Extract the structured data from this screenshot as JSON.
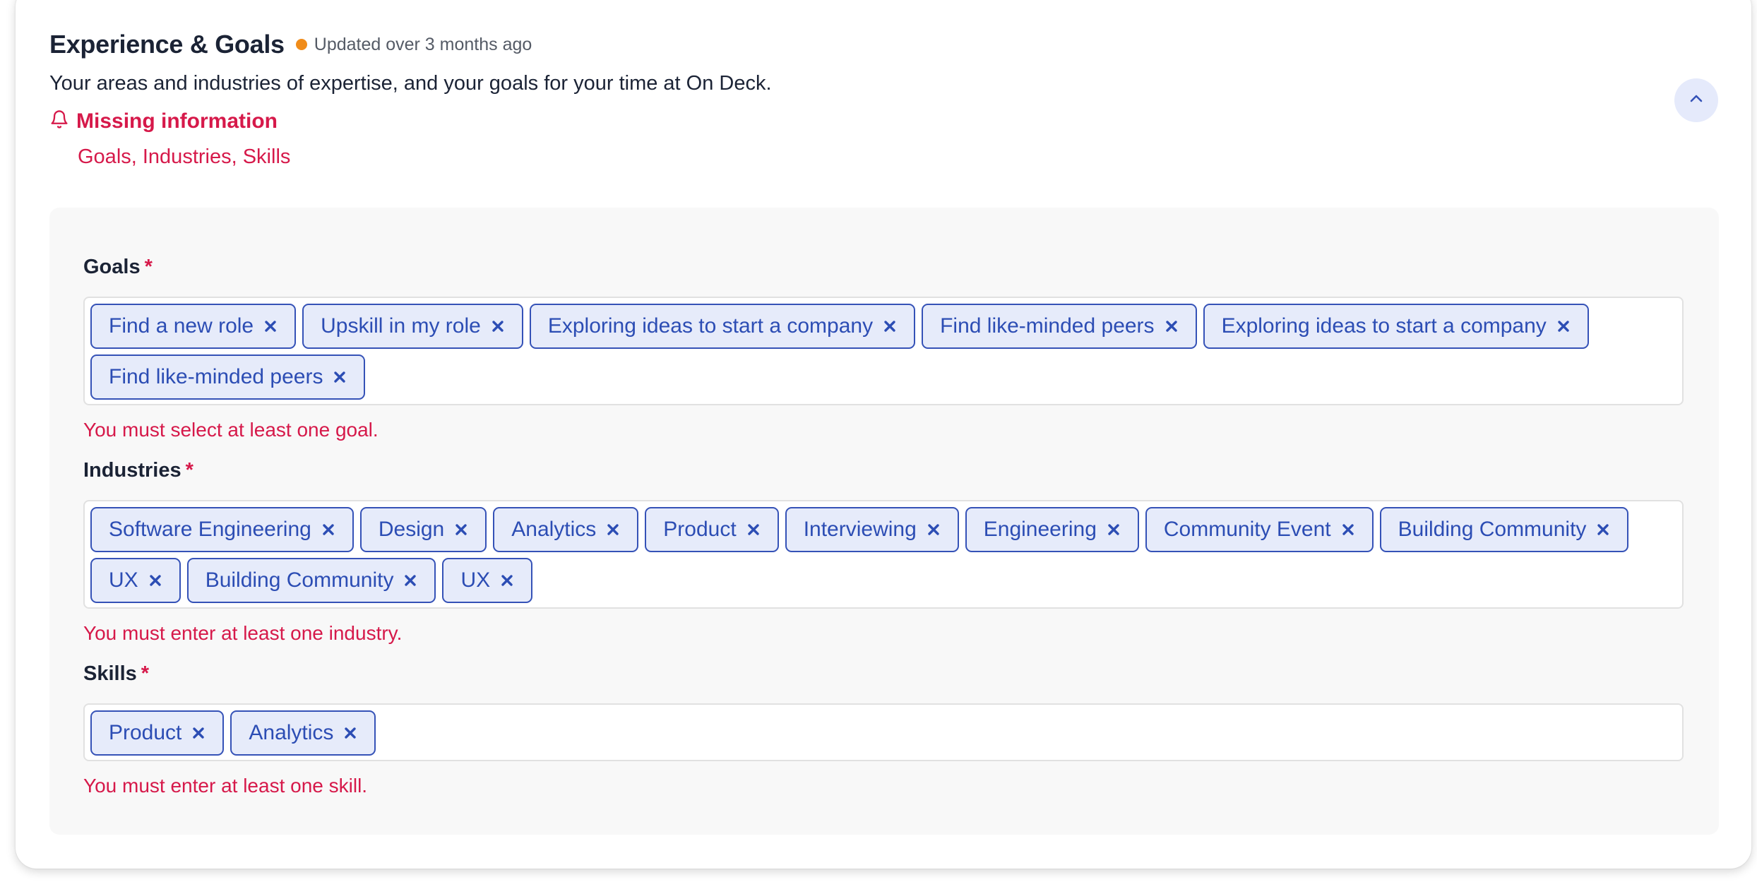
{
  "header": {
    "title": "Experience & Goals",
    "updated": "Updated over 3 months ago",
    "status_color": "#f08c1a",
    "description": "Your areas and industries of expertise, and your goals for your time at On Deck.",
    "missing_title": "Missing information",
    "missing_list": "Goals, Industries, Skills",
    "bell_icon": "bell-icon",
    "collapse_icon": "chevron-up-icon"
  },
  "fields": {
    "goals": {
      "label": "Goals",
      "required_mark": "*",
      "tags": [
        "Find a new role",
        "Upskill in my role",
        "Exploring ideas to start a company",
        "Find like-minded peers",
        "Exploring ideas to start a company",
        "Find like-minded peers"
      ],
      "error": "You must select at least one goal."
    },
    "industries": {
      "label": "Industries",
      "required_mark": "*",
      "tags": [
        "Software Engineering",
        "Design",
        "Analytics",
        "Product",
        "Interviewing",
        "Engineering",
        "Community Event",
        "Building Community",
        "UX",
        "Building Community",
        "UX"
      ],
      "error": "You must enter at least one industry."
    },
    "skills": {
      "label": "Skills",
      "required_mark": "*",
      "tags": [
        "Product",
        "Analytics"
      ],
      "error": "You must enter at least one skill."
    }
  },
  "colors": {
    "accent": "#2c4db4",
    "tag_bg": "#e6ebfa",
    "error": "#d6194a"
  }
}
